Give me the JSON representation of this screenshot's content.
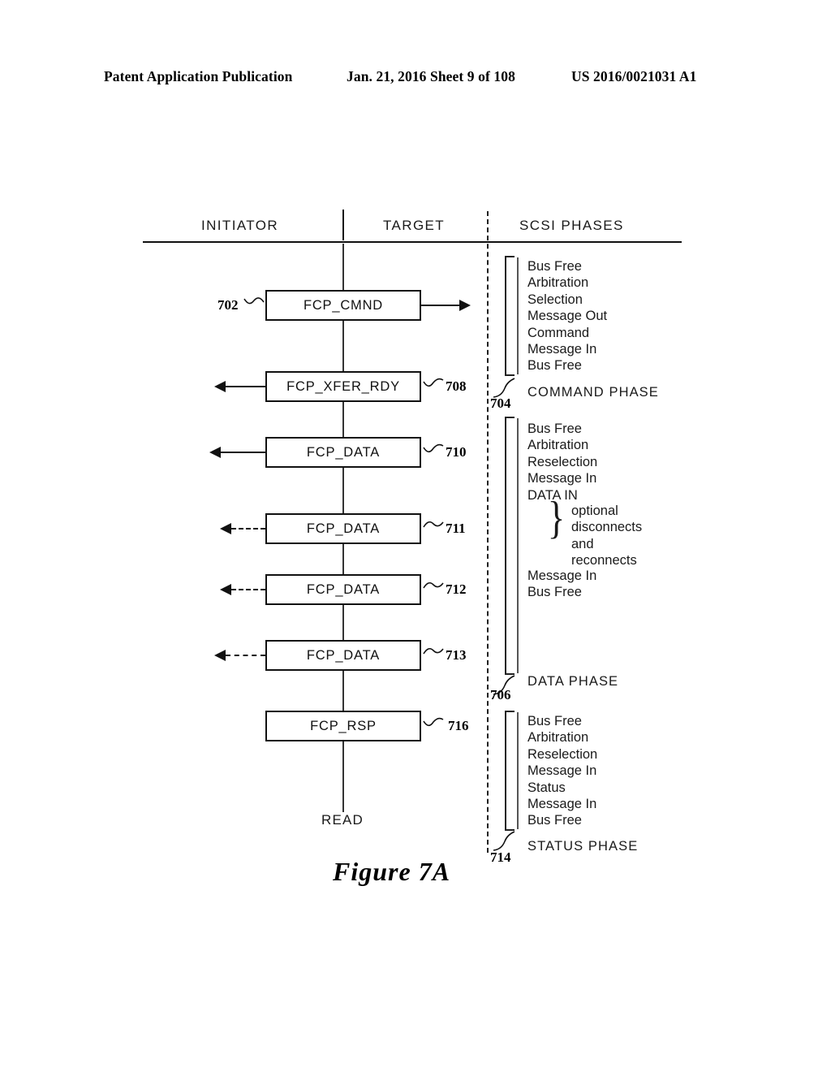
{
  "header": {
    "publication": "Patent Application Publication",
    "date_sheet": "Jan. 21, 2016  Sheet 9 of 108",
    "patent_number": "US 2016/0021031 A1"
  },
  "figure": {
    "caption": "Figure 7A",
    "bottom_label": "READ",
    "columns": [
      {
        "label": "INITIATOR"
      },
      {
        "label": "TARGET"
      },
      {
        "label": "SCSI PHASES"
      }
    ],
    "messages": [
      {
        "label": "FCP_CMND",
        "ref": "702",
        "direction": "right",
        "style": "solid",
        "ref_side": "left"
      },
      {
        "label": "FCP_XFER_RDY",
        "ref": "708",
        "direction": "left",
        "style": "solid",
        "ref_side": "right"
      },
      {
        "label": "FCP_DATA",
        "ref": "710",
        "direction": "left",
        "style": "solid",
        "ref_side": "right"
      },
      {
        "label": "FCP_DATA",
        "ref": "711",
        "direction": "left",
        "style": "dashed",
        "ref_side": "right"
      },
      {
        "label": "FCP_DATA",
        "ref": "712",
        "direction": "left",
        "style": "dashed",
        "ref_side": "right"
      },
      {
        "label": "FCP_DATA",
        "ref": "713",
        "direction": "left",
        "style": "dashed",
        "ref_side": "right"
      },
      {
        "label": "FCP_RSP",
        "ref": "716",
        "direction": "none",
        "style": "none",
        "ref_side": "right"
      }
    ],
    "phases": [
      {
        "ref": "704",
        "label": "COMMAND PHASE",
        "steps": [
          "Bus Free",
          "Arbitration",
          "Selection",
          "Message Out",
          "Command",
          "Message In",
          "Bus Free"
        ]
      },
      {
        "ref": "706",
        "label": "DATA PHASE",
        "steps": [
          "Bus Free",
          "Arbitration",
          "Reselection",
          "Message In",
          "DATA IN"
        ],
        "brace_note": [
          "optional",
          "disconnects",
          "and",
          "reconnects"
        ],
        "steps_after": [
          "Message In",
          "Bus Free"
        ]
      },
      {
        "ref": "714",
        "label": "STATUS PHASE",
        "steps": [
          "Bus Free",
          "Arbitration",
          "Reselection",
          "Message In",
          "Status",
          "Message In",
          "Bus Free"
        ]
      }
    ]
  }
}
